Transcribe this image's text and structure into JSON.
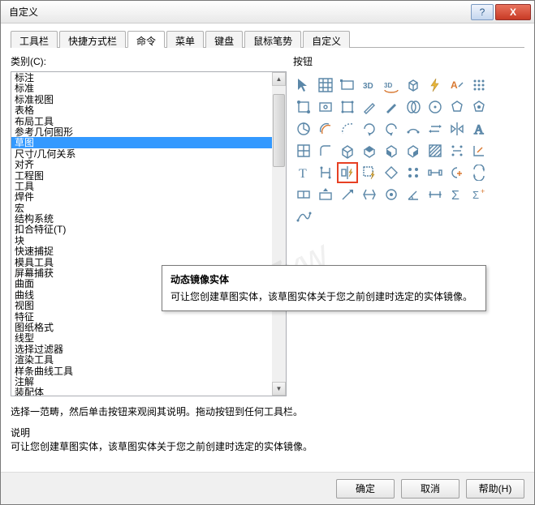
{
  "window": {
    "title": "自定义"
  },
  "titlebar_buttons": {
    "help": "?",
    "close": "X"
  },
  "tabs": [
    {
      "label": "工具栏",
      "active": false
    },
    {
      "label": "快捷方式栏",
      "active": false
    },
    {
      "label": "命令",
      "active": true
    },
    {
      "label": "菜单",
      "active": false
    },
    {
      "label": "键盘",
      "active": false
    },
    {
      "label": "鼠标笔势",
      "active": false
    },
    {
      "label": "自定义",
      "active": false
    }
  ],
  "left": {
    "label": "类别(C):",
    "items": [
      "标注",
      "标准",
      "标准视图",
      "表格",
      "布局工具",
      "参考几何图形",
      "草图",
      "尺寸/几何关系",
      "对齐",
      "工程图",
      "工具",
      "焊件",
      "宏",
      "结构系统",
      "扣合特征(T)",
      "块",
      "快速捕捉",
      "模具工具",
      "屏幕捕获",
      "曲面",
      "曲线",
      "视图",
      "特征",
      "图纸格式",
      "线型",
      "选择过滤器",
      "渲染工具",
      "样条曲线工具",
      "注解",
      "装配体"
    ],
    "selected_index": 6
  },
  "right": {
    "label": "按钮"
  },
  "tooltip": {
    "title": "动态镜像实体",
    "body": "可让您创建草图实体，该草图实体关于您之前创建时选定的实体镜像。"
  },
  "instructions": "选择一范畴，然后单击按钮来观阅其说明。拖动按钮到任何工具栏。",
  "description_label": "说明",
  "description_text": "可让您创建草图实体，该草图实体关于您之前创建时选定的实体镜像。",
  "footer": {
    "ok": "确定",
    "cancel": "取消",
    "help": "帮助(H)"
  },
  "watermark": "rjZxw",
  "icons": [
    "cursor",
    "grid",
    "rect-corner",
    "3d",
    "3d-rot",
    "cube",
    "bolt",
    "a-pen",
    "dot-grid",
    "node-rect",
    "eye-rect",
    "nodes",
    "pencil",
    "pencil-fill",
    "double-ellipse",
    "circle-center",
    "poly",
    "poly-filled",
    "pie",
    "offset-c",
    "dashed-arc",
    "arc-cw",
    "arc-ccw",
    "arc-open",
    "swap",
    "mirror",
    "A-tool",
    "grid2",
    "fillet",
    "cube2",
    "iso1",
    "iso2",
    "iso3",
    "hatch",
    "dim-dots",
    "corner-k",
    "T",
    "H",
    "mirror-bolt",
    "select-bolt",
    "diamond",
    "dots-2x2",
    "stretch",
    "half-plus",
    "swap2",
    "tol",
    "tol-up",
    "arrow-ur",
    "flip",
    "circle-dot",
    "angle",
    "dim",
    "sigma",
    "sigma-plus",
    "spline-edit"
  ],
  "highlighted_icon_index": 38
}
